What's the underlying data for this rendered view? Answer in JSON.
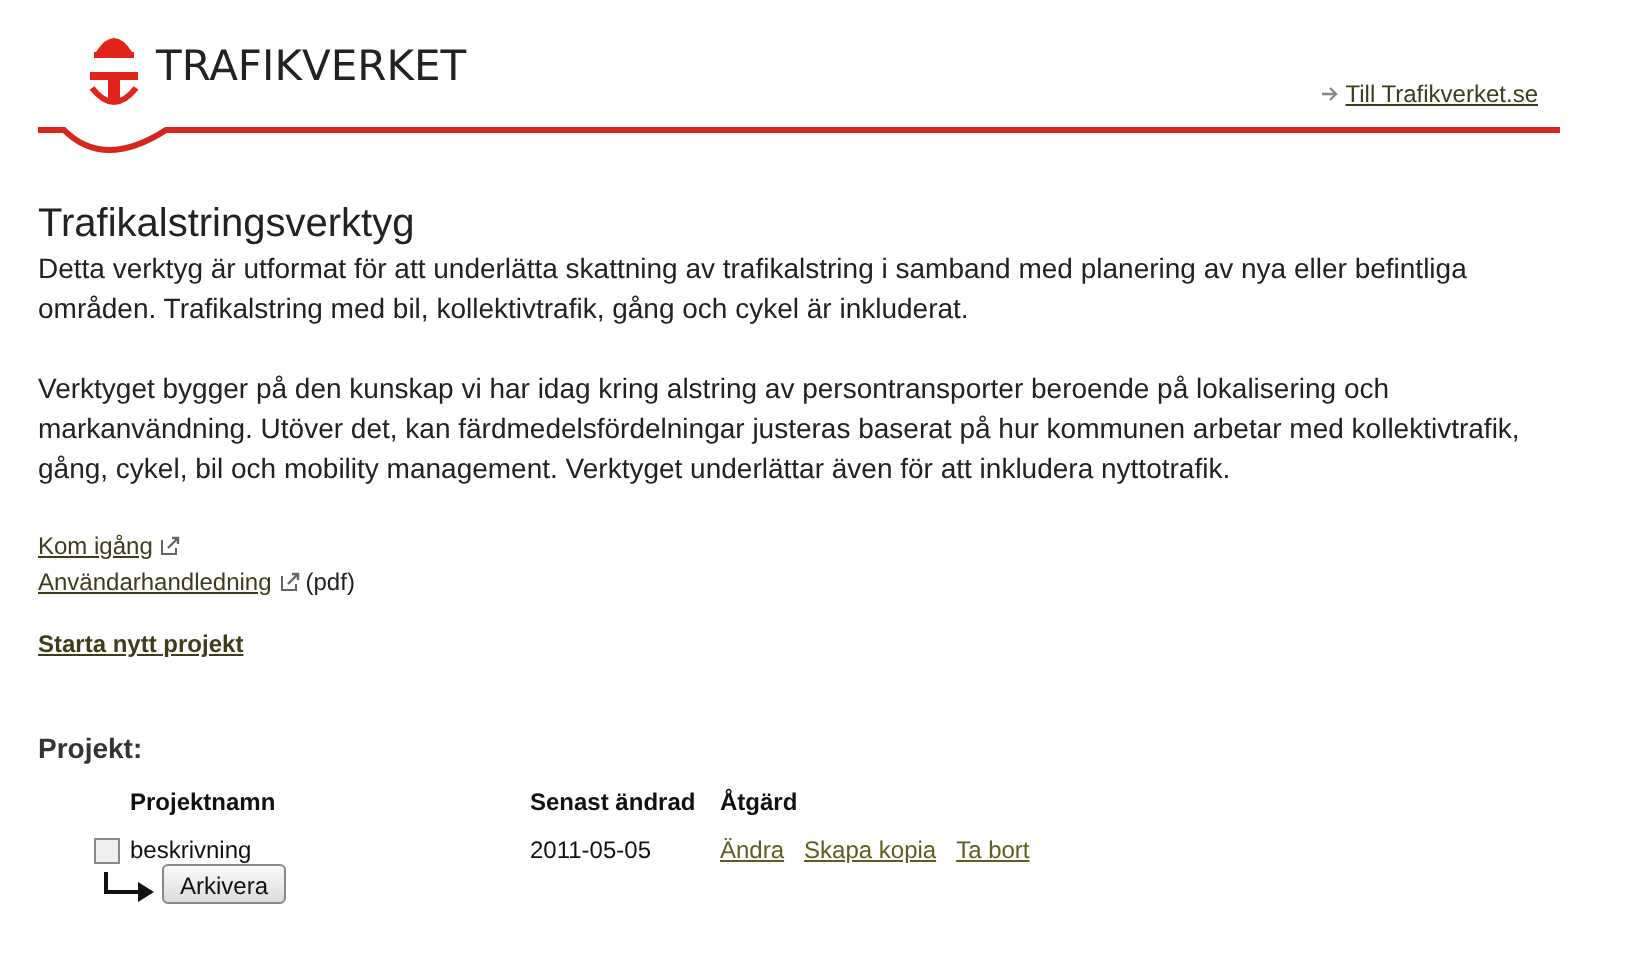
{
  "header": {
    "logo_text": "TRAFIKVERKET",
    "site_link": "Till Trafikverket.se"
  },
  "title": "Trafikalstringsverktyg",
  "paragraphs": [
    "Detta verktyg är utformat för att underlätta skattning av trafikalstring i samband med planering av nya eller befintliga områden. Trafikalstring med bil, kollektivtrafik, gång och cykel är inkluderat.",
    "Verktyget bygger på den kunskap vi har idag kring alstring av persontransporter beroende på lokalisering och markanvändning. Utöver det, kan färdmedelsfördelningar justeras baserat på hur kommunen arbetar med kollektivtrafik, gång, cykel, bil och mobility management. Verktyget underlättar även för att inkludera nyttotrafik."
  ],
  "links": [
    {
      "label": "Kom igång"
    },
    {
      "label": "Användarhandledning",
      "suffix": "(pdf)"
    }
  ],
  "new_project": "Starta nytt projekt",
  "projects": {
    "heading": "Projekt:",
    "columns": [
      "Projektnamn",
      "Senast ändrad",
      "Åtgärd"
    ],
    "rows": [
      {
        "name": "beskrivning",
        "checked": false,
        "modified": "2011-05-05",
        "actions": [
          "Ändra",
          "Skapa kopia",
          "Ta bort"
        ]
      }
    ],
    "archive_button": "Arkivera"
  }
}
